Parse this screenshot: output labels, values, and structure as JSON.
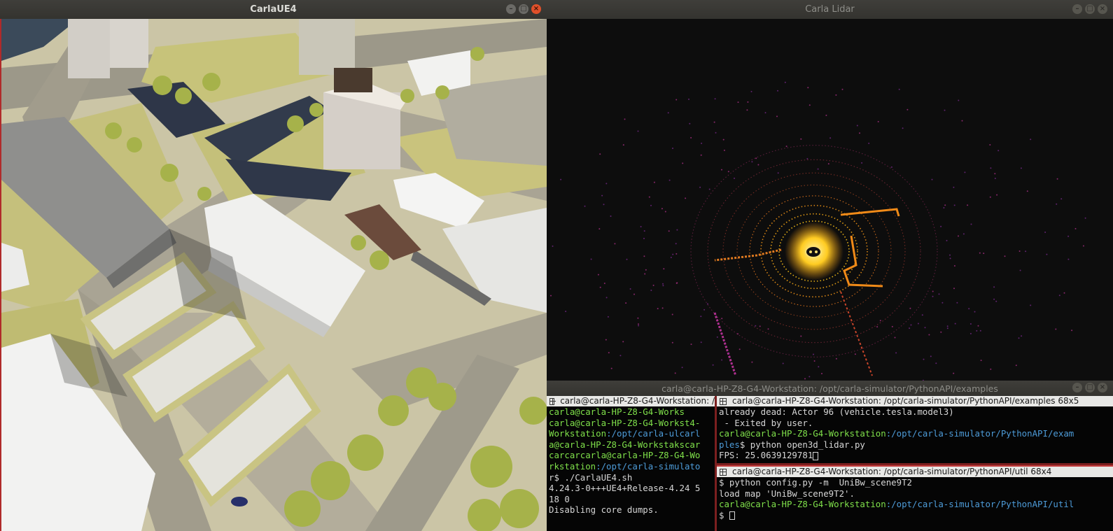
{
  "carla_window": {
    "title": "CarlaUE4"
  },
  "lidar_window": {
    "title": "Carla Lidar"
  },
  "terminal_window": {
    "title": "carla@carla-HP-Z8-G4-Workstation: /opt/carla-simulator/PythonAPI/examples",
    "left_pane": {
      "header": "carla@carla-HP-Z8-G4-Workstation: /",
      "lines": [
        [
          {
            "t": "carla@carla-HP-Z8-G4-Works",
            "c": "g"
          }
        ],
        [
          {
            "t": "carla@carla-HP-Z8-G4-Workst4-",
            "c": "g"
          }
        ],
        [
          {
            "t": "Workstation",
            "c": "g"
          },
          {
            "t": ":/opt/carla-ulcarl",
            "c": "b"
          }
        ],
        [
          {
            "t": "a@carla-HP-Z8-G4-Workstakscar",
            "c": "g"
          }
        ],
        [
          {
            "t": "carcarcarla@carla-HP-Z8-G4-Wo",
            "c": "g"
          }
        ],
        [
          {
            "t": "rkstation",
            "c": "g"
          },
          {
            "t": ":/opt/carla-simulato",
            "c": "b"
          }
        ],
        [
          {
            "t": "r$ ./CarlaUE4.sh",
            "c": ""
          }
        ],
        [
          {
            "t": "4.24.3-0+++UE4+Release-4.24 5",
            "c": ""
          }
        ],
        [
          {
            "t": "18 0",
            "c": ""
          }
        ],
        [
          {
            "t": "Disabling core dumps.",
            "c": ""
          }
        ]
      ]
    },
    "top_right_pane": {
      "header": "carla@carla-HP-Z8-G4-Workstation: /opt/carla-simulator/PythonAPI/examples 68x5",
      "lines": [
        [
          {
            "t": "already dead: Actor 96 (vehicle.tesla.model3)",
            "c": ""
          }
        ],
        [
          {
            "t": " - Exited by user.",
            "c": ""
          }
        ],
        [
          {
            "t": "carla@carla-HP-Z8-G4-Workstation",
            "c": "g"
          },
          {
            "t": ":/opt/carla-simulator/PythonAPI/exam",
            "c": "b"
          }
        ],
        [
          {
            "t": "ples",
            "c": "b"
          },
          {
            "t": "$ python open3d_lidar.py",
            "c": ""
          }
        ],
        [
          {
            "t": "FPS: 25.0639129781",
            "c": ""
          }
        ]
      ]
    },
    "bottom_right_pane": {
      "header": "carla@carla-HP-Z8-G4-Workstation: /opt/carla-simulator/PythonAPI/util 68x4",
      "lines": [
        [
          {
            "t": "$ python config.py -m  UniBw_scene9T2",
            "c": ""
          }
        ],
        [
          {
            "t": "load map 'UniBw_scene9T2'.",
            "c": ""
          }
        ],
        [
          {
            "t": "carla@carla-HP-Z8-G4-Workstation",
            "c": "g"
          },
          {
            "t": ":/opt/carla-simulator/PythonAPI/util",
            "c": "b"
          }
        ],
        [
          {
            "t": "$ ",
            "c": ""
          }
        ]
      ]
    }
  },
  "colors": {
    "prompt_green": "#7fe04a",
    "path_blue": "#4d9bd8",
    "lidar_core": "#ffcc22",
    "lidar_far": "#b0308a"
  }
}
